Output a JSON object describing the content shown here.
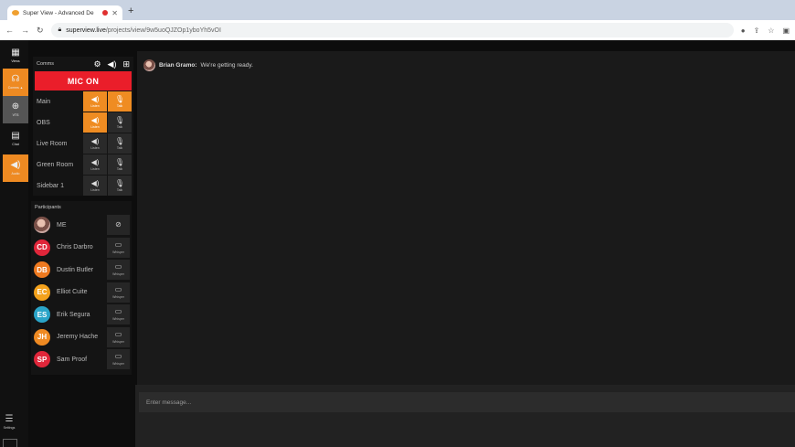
{
  "browser": {
    "tab_title": "Super View - Advanced De",
    "tab_close": "✕",
    "new_tab": "+",
    "url_domain": "superview.live",
    "url_path": "/projects/view/9w5uoQJZOp1yboYh5vOI"
  },
  "rail": {
    "items": [
      {
        "label": "Views",
        "icon": "▦"
      },
      {
        "label": "Comms ▲",
        "icon": "☊"
      },
      {
        "label": "VTS",
        "icon": "⊕"
      },
      {
        "label": "Chat",
        "icon": "▤"
      },
      {
        "label": "Audio",
        "icon": "◀)"
      }
    ],
    "settings_label": "Settings",
    "settings_icon": "☰"
  },
  "comms": {
    "title": "Comms",
    "mic_label": "MIC ON",
    "listen_label": "Listen",
    "talk_label": "Talk",
    "channels": [
      {
        "name": "Main",
        "listen_on": true,
        "talk_on": true
      },
      {
        "name": "OBS",
        "listen_on": true,
        "talk_on": false
      },
      {
        "name": "Live Room",
        "listen_on": false,
        "talk_on": false
      },
      {
        "name": "Green Room",
        "listen_on": false,
        "talk_on": false
      },
      {
        "name": "Sidebar 1",
        "listen_on": false,
        "talk_on": false
      }
    ]
  },
  "participants": {
    "title": "Participants",
    "whisper_label": "Whisper",
    "me": {
      "name": "ME"
    },
    "list": [
      {
        "initials": "CD",
        "name": "Chris Darbro",
        "color": "#e0263a"
      },
      {
        "initials": "DB",
        "name": "Dustin Butler",
        "color": "#ef7a20"
      },
      {
        "initials": "EC",
        "name": "Elliot Cuite",
        "color": "#f4a21c"
      },
      {
        "initials": "ES",
        "name": "Erik Segura",
        "color": "#2aa4c8"
      },
      {
        "initials": "JH",
        "name": "Jeremy Hache",
        "color": "#ef8a22"
      },
      {
        "initials": "SP",
        "name": "Sam Proof",
        "color": "#e0263a"
      }
    ]
  },
  "chat": {
    "messages": [
      {
        "author": "Brian Gramo:",
        "text": "We're getting ready."
      }
    ],
    "input_placeholder": "Enter message..."
  }
}
